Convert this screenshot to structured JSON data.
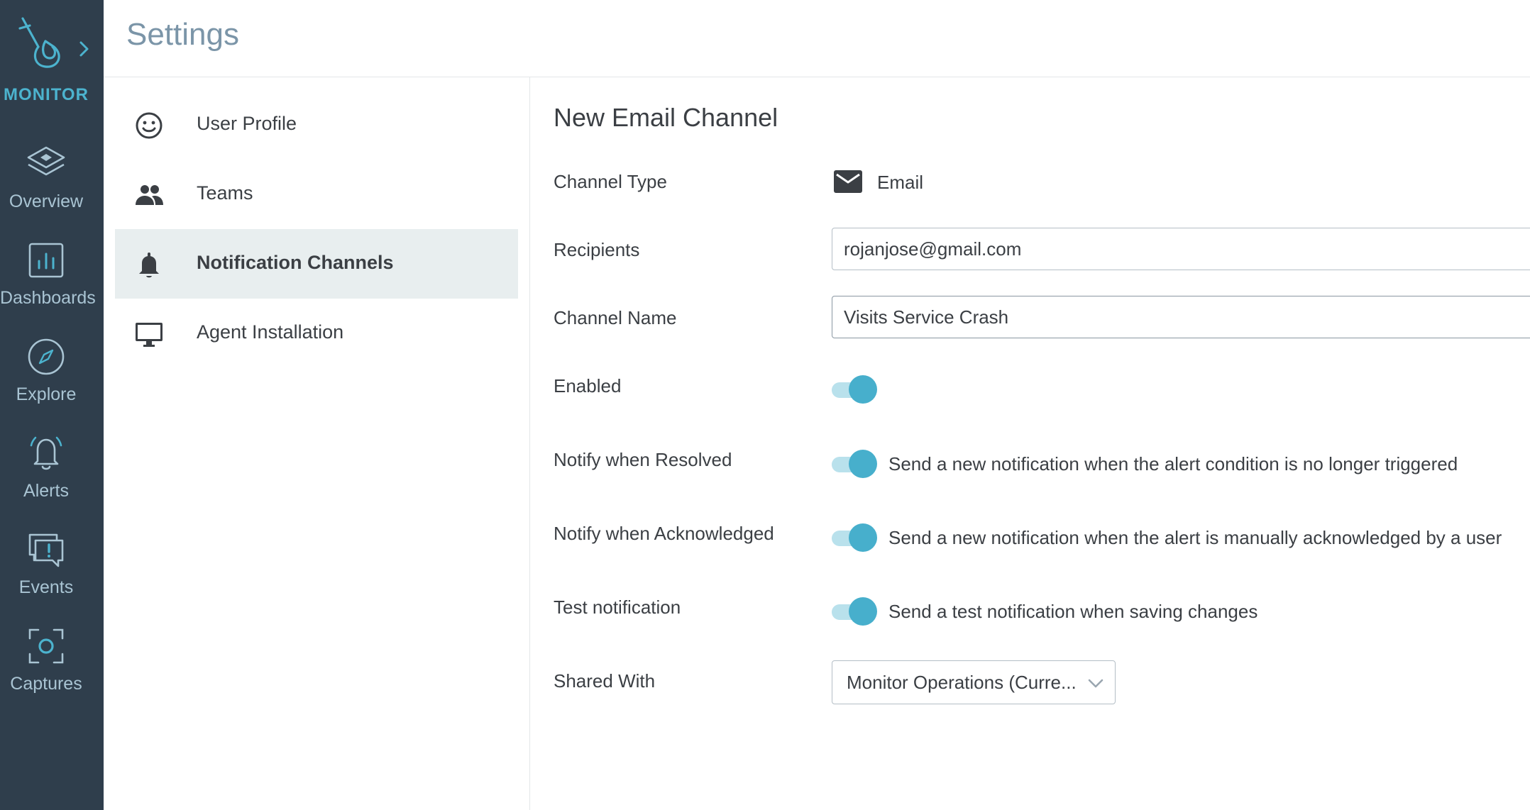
{
  "brand": {
    "name": "MONITOR",
    "color": "#4cb3ce"
  },
  "rail": {
    "items": [
      {
        "label": "Overview",
        "icon": "layers-icon"
      },
      {
        "label": "Dashboards",
        "icon": "bar-chart-icon"
      },
      {
        "label": "Explore",
        "icon": "compass-icon"
      },
      {
        "label": "Alerts",
        "icon": "bell-icon"
      },
      {
        "label": "Events",
        "icon": "chat-alert-icon"
      },
      {
        "label": "Captures",
        "icon": "capture-icon"
      }
    ]
  },
  "header": {
    "title": "Settings"
  },
  "subnav": {
    "items": [
      {
        "label": "User Profile",
        "icon": "smiley-icon",
        "active": false
      },
      {
        "label": "Teams",
        "icon": "people-icon",
        "active": false
      },
      {
        "label": "Notification Channels",
        "icon": "bell-icon",
        "active": true
      },
      {
        "label": "Agent Installation",
        "icon": "monitor-icon",
        "active": false
      }
    ]
  },
  "form": {
    "title": "New Email Channel",
    "channel_type": {
      "label": "Channel Type",
      "value": "Email",
      "icon": "envelope-icon"
    },
    "recipients": {
      "label": "Recipients",
      "value": "rojanjose@gmail.com"
    },
    "channel_name": {
      "label": "Channel Name",
      "value": "Visits Service Crash"
    },
    "enabled": {
      "label": "Enabled",
      "on": true
    },
    "notify_resolved": {
      "label": "Notify when Resolved",
      "description": "Send a new notification when the alert condition is no longer triggered",
      "on": true
    },
    "notify_acknowledged": {
      "label": "Notify when Acknowledged",
      "description": "Send a new notification when the alert is manually acknowledged by a user",
      "on": true
    },
    "test_notification": {
      "label": "Test notification",
      "description": "Send a test notification when saving changes",
      "on": true
    },
    "shared_with": {
      "label": "Shared With",
      "value": "Monitor Operations (Curre..."
    }
  },
  "colors": {
    "rail_bg": "#2f3e4c",
    "accent": "#47afcc",
    "toggle_track": "#b9e1ec",
    "active_bg": "#e8eeef",
    "title_gray": "#7b95a8"
  }
}
